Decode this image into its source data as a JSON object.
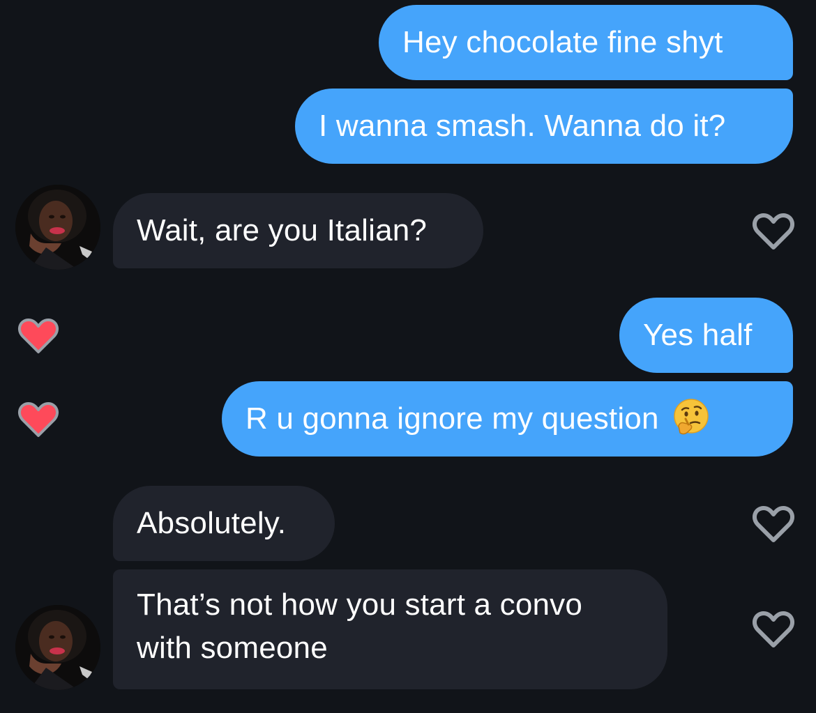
{
  "theme": {
    "background": "#111419",
    "outgoing_bubble": "#45a4fb",
    "incoming_bubble": "#20232c",
    "liked_heart": "#fe4a5a",
    "heart_outline": "#9aa0a8"
  },
  "messages": [
    {
      "id": "m1",
      "direction": "outgoing",
      "text": "Hey chocolate fine shyt"
    },
    {
      "id": "m2",
      "direction": "outgoing",
      "text": "I wanna smash. Wanna do it?"
    },
    {
      "id": "m3",
      "direction": "incoming",
      "text": "Wait, are you Italian?",
      "like_icon": "heart-outline-icon"
    },
    {
      "id": "m4",
      "direction": "outgoing",
      "text": "Yes half",
      "liked_icon": "heart-filled-icon"
    },
    {
      "id": "m5",
      "direction": "outgoing",
      "text": "R u gonna ignore my question",
      "emoji": "thinking-face-emoji",
      "liked_icon": "heart-filled-icon"
    },
    {
      "id": "m6",
      "direction": "incoming",
      "text": "Absolutely.",
      "like_icon": "heart-outline-icon"
    },
    {
      "id": "m7",
      "direction": "incoming",
      "text": "That’s not how you start a convo with someone",
      "like_icon": "heart-outline-icon"
    }
  ]
}
